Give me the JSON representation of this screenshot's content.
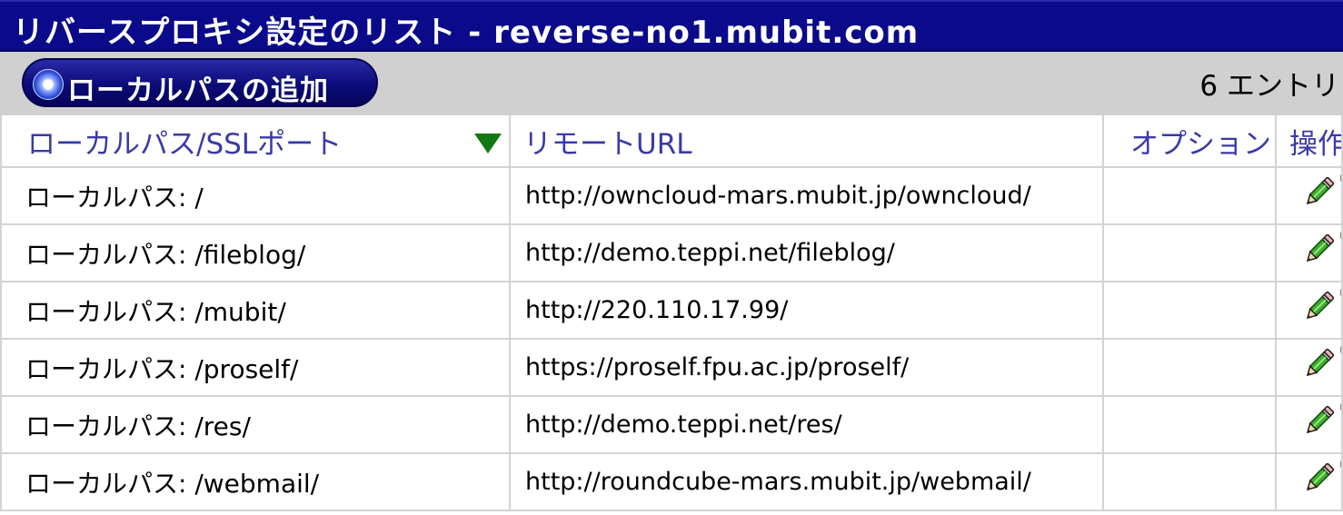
{
  "header": {
    "title": "リバースプロキシ設定のリスト - reverse-no1.mubit.com"
  },
  "toolbar": {
    "add_label": "ローカルパスの追加",
    "entry_count": "6 エントリ"
  },
  "table": {
    "columns": {
      "local": "ローカルパス/SSLポート",
      "remote": "リモートURL",
      "options": "オプション",
      "operations": "操作"
    },
    "sort": {
      "column": "local",
      "direction": "descending"
    },
    "rows": [
      {
        "local": "ローカルパス: /",
        "remote": "http://owncloud-mars.mubit.jp/owncloud/",
        "options": ""
      },
      {
        "local": "ローカルパス: /fileblog/",
        "remote": "http://demo.teppi.net/fileblog/",
        "options": ""
      },
      {
        "local": "ローカルパス: /mubit/",
        "remote": "http://220.110.17.99/",
        "options": ""
      },
      {
        "local": "ローカルパス: /proself/",
        "remote": "https://proself.fpu.ac.jp/proself/",
        "options": ""
      },
      {
        "local": "ローカルパス: /res/",
        "remote": "http://demo.teppi.net/res/",
        "options": ""
      },
      {
        "local": "ローカルパス: /webmail/",
        "remote": "http://roundcube-mars.mubit.jp/webmail/",
        "options": ""
      }
    ]
  },
  "icons": {
    "edit": "pencil-icon",
    "delete": "trash-icon"
  },
  "colors": {
    "title_bar": "#0a0a8a",
    "toolbar_bg": "#d0d0d0",
    "header_text": "#3a3aa8",
    "sort_arrow": "#127812",
    "delete_red": "#b00000"
  }
}
